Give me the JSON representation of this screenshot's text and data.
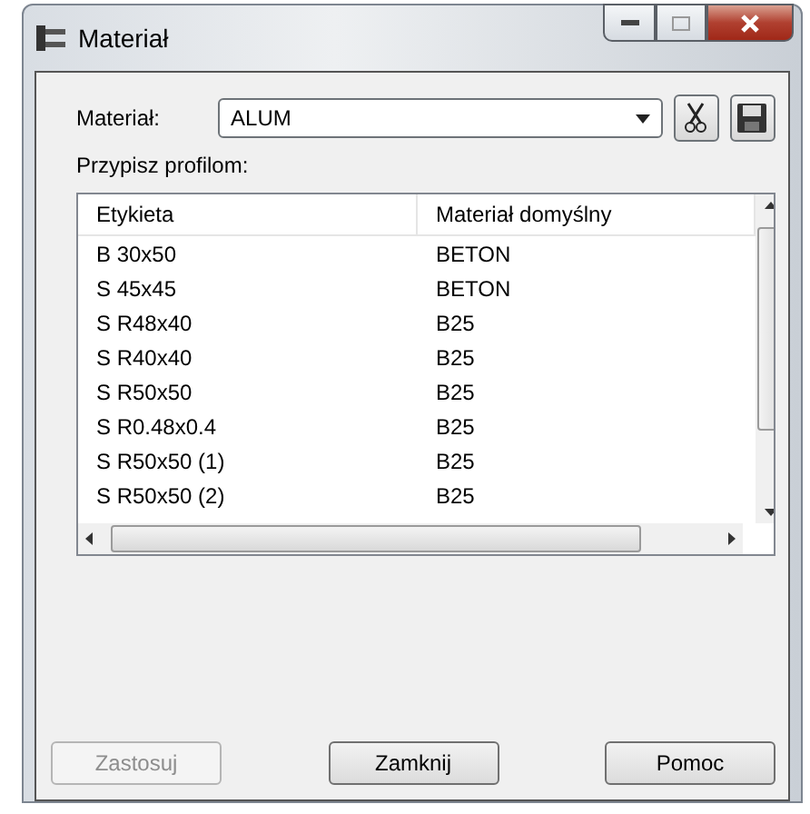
{
  "window": {
    "title": "Materiał"
  },
  "material": {
    "label": "Materiał:",
    "value": "ALUM"
  },
  "assign_label": "Przypisz profilom:",
  "table": {
    "columns": [
      "Etykieta",
      "Materiał domyślny"
    ],
    "rows": [
      [
        "B 30x50",
        "BETON"
      ],
      [
        "S 45x45",
        "BETON"
      ],
      [
        "S R48x40",
        "B25"
      ],
      [
        "S R40x40",
        "B25"
      ],
      [
        "S R50x50",
        "B25"
      ],
      [
        "S R0.48x0.4",
        "B25"
      ],
      [
        "S R50x50 (1)",
        "B25"
      ],
      [
        "S R50x50 (2)",
        "B25"
      ]
    ]
  },
  "buttons": [
    {
      "label": "Zastosuj",
      "disabled": true
    },
    {
      "label": "Zamknij",
      "disabled": false
    },
    {
      "label": "Pomoc",
      "disabled": false
    }
  ]
}
